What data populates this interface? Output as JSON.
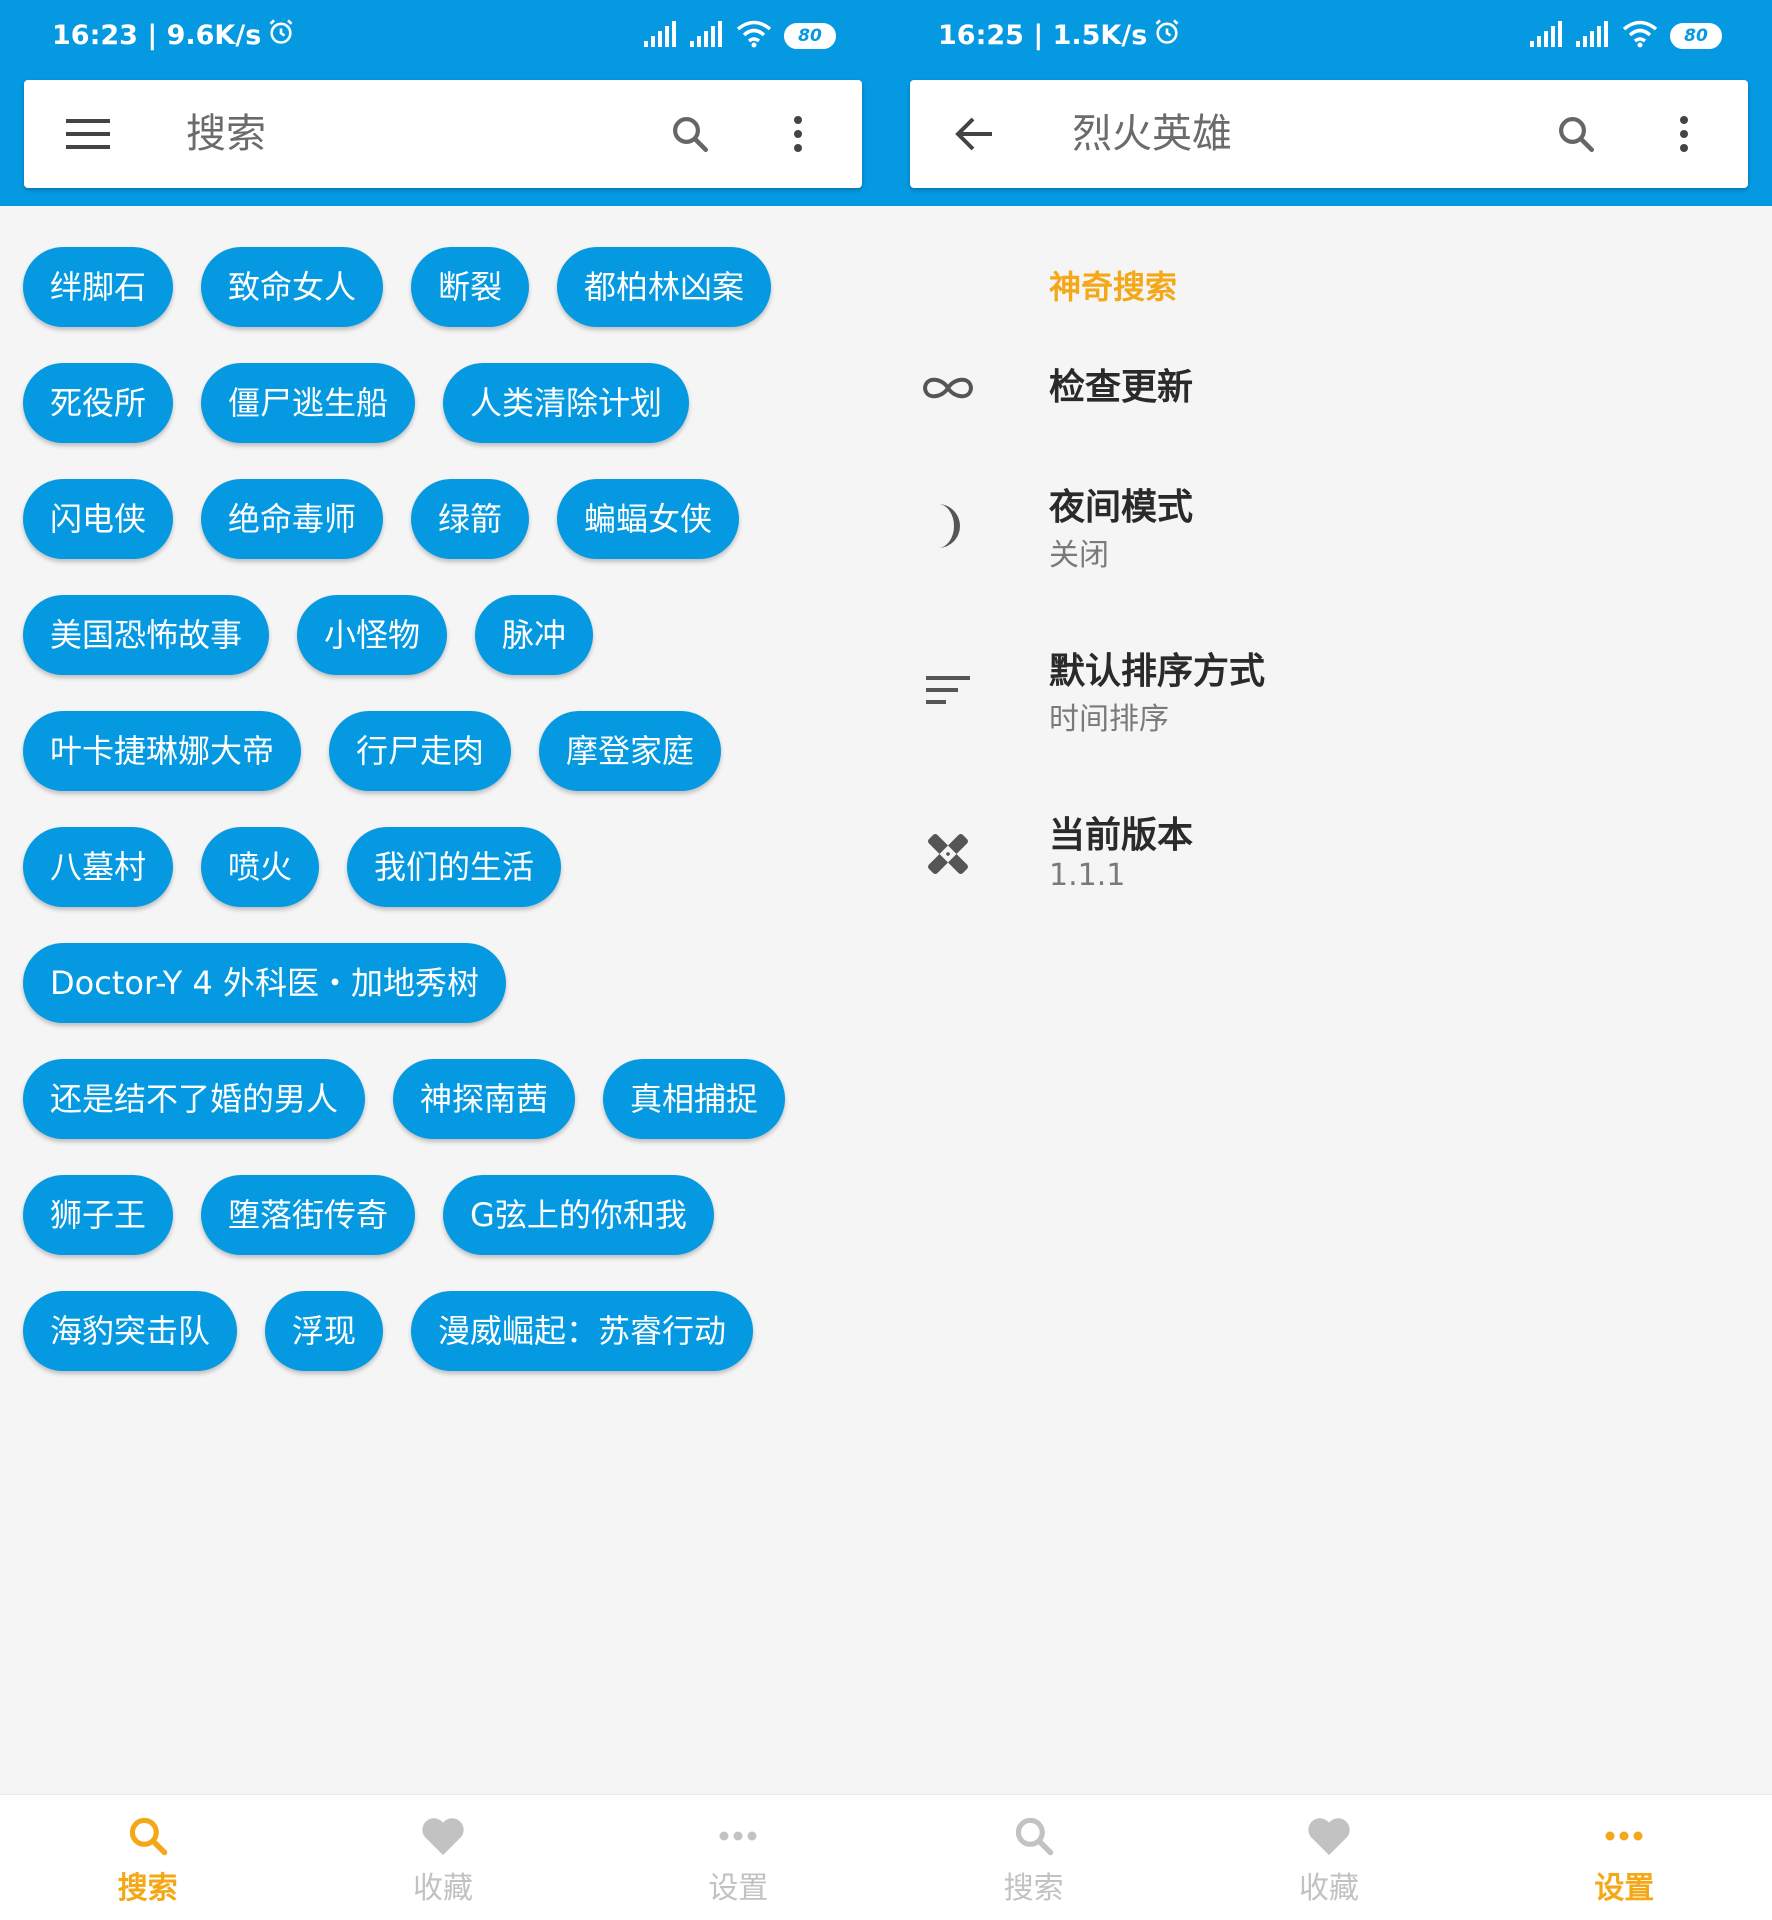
{
  "left": {
    "status": {
      "time_speed": "16:23 | 9.6K/s",
      "battery": "80"
    },
    "search_bar": {
      "placeholder": "搜索"
    },
    "tag_rows": [
      [
        "绊脚石",
        "致命女人",
        "断裂",
        "都柏林凶案"
      ],
      [
        "死役所",
        "僵尸逃生船",
        "人类清除计划"
      ],
      [
        "闪电侠",
        "绝命毒师",
        "绿箭",
        "蝙蝠女侠"
      ],
      [
        "美国恐怖故事",
        "小怪物",
        "脉冲"
      ],
      [
        "叶卡捷琳娜大帝",
        "行尸走肉",
        "摩登家庭"
      ],
      [
        "八墓村",
        "喷火",
        "我们的生活"
      ],
      [
        "Doctor-Y 4 外科医・加地秀树"
      ],
      [
        "还是结不了婚的男人",
        "神探南茜",
        "真相捕捉"
      ],
      [
        "狮子王",
        "堕落街传奇",
        "G弦上的你和我"
      ],
      [
        "海豹突击队",
        "浮现",
        "漫威崛起：苏睿行动"
      ]
    ],
    "nav": {
      "search": "搜索",
      "favorites": "收藏",
      "settings": "设置",
      "active": "search"
    }
  },
  "right": {
    "status": {
      "time_speed": "16:25 | 1.5K/s",
      "battery": "80"
    },
    "search_bar": {
      "query": "烈火英雄"
    },
    "settings": {
      "header": "神奇搜索",
      "items": [
        {
          "title": "检查更新",
          "subtitle": "",
          "icon": "infinity-icon"
        },
        {
          "title": "夜间模式",
          "subtitle": "关闭",
          "icon": "moon-icon"
        },
        {
          "title": "默认排序方式",
          "subtitle": "时间排序",
          "icon": "sort-icon"
        },
        {
          "title": "当前版本",
          "subtitle": "1.1.1",
          "icon": "bandage-icon"
        }
      ]
    },
    "nav": {
      "search": "搜索",
      "favorites": "收藏",
      "settings": "设置",
      "active": "settings"
    }
  },
  "colors": {
    "primary": "#0599e2",
    "accent": "#f4a818",
    "nav_inactive": "#c2c2c2",
    "background": "#f5f5f5"
  }
}
